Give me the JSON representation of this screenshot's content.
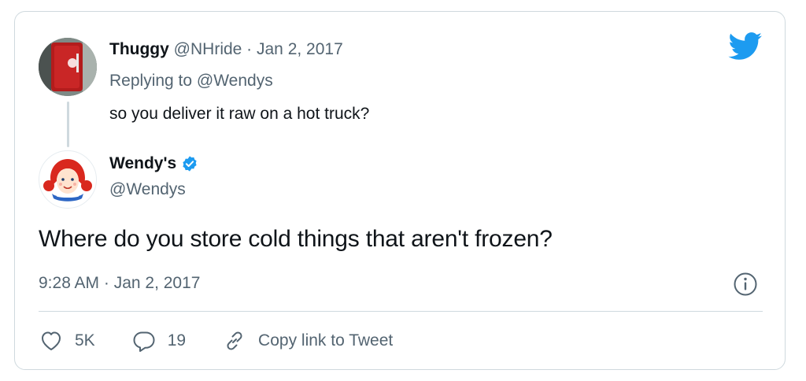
{
  "reply": {
    "name": "Thuggy",
    "handle_time": "@NHride · Jan 2, 2017",
    "replying_prefix": "Replying to ",
    "replying_to": "@Wendys",
    "text": "so you deliver it raw on a hot truck?"
  },
  "main": {
    "name": "Wendy's",
    "handle": "@Wendys",
    "text": "Where do you store cold things that aren't frozen?",
    "timestamp": "9:28 AM · Jan 2, 2017"
  },
  "actions": {
    "likes": "5K",
    "replies": "19",
    "copy_link": "Copy link to Tweet"
  },
  "icons": {
    "brand": "twitter-bird-icon",
    "verified": "verified-badge-icon",
    "info": "info-icon",
    "like": "heart-icon",
    "reply": "reply-bubble-icon",
    "link": "link-icon"
  },
  "colors": {
    "accent": "#1d9bf0",
    "text": "#0f1419",
    "muted": "#536471",
    "border": "#cfd9de"
  }
}
